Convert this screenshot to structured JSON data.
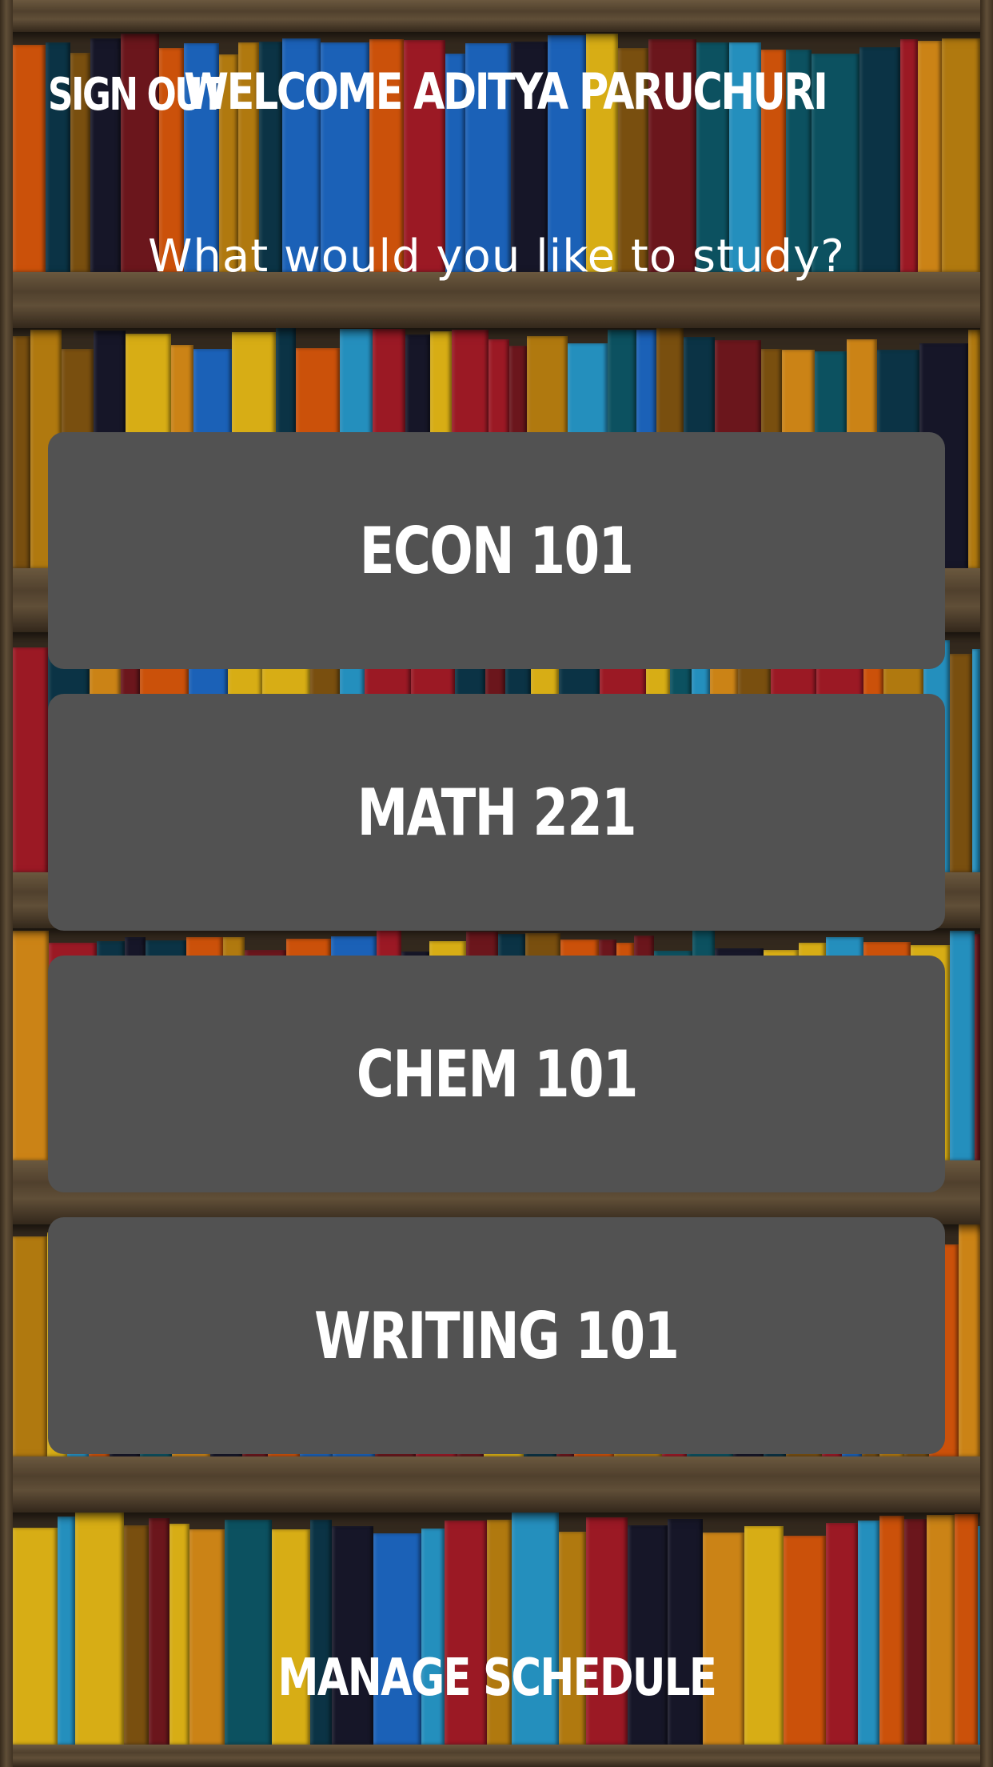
{
  "header": {
    "sign_out_label": "SIGN OUT",
    "welcome_title": "WELCOME ADITYA PARUCHURI"
  },
  "prompt": "What would you like to study?",
  "courses": [
    {
      "label": "ECON 101"
    },
    {
      "label": "MATH 221"
    },
    {
      "label": "CHEM 101"
    },
    {
      "label": "WRITING 101"
    }
  ],
  "footer": {
    "manage_schedule_label": "MANAGE SCHEDULE"
  },
  "colors": {
    "button_bg": "#525252",
    "text": "#ffffff",
    "shelf_wood": "#5c4a34"
  },
  "background": {
    "book_colors": [
      "#f5c518",
      "#e85d0c",
      "#1f6fd1",
      "#2aa3d8",
      "#b11d2a",
      "#7a1a20",
      "#0d3b4f",
      "#8a5a12",
      "#e8961a",
      "#1a1a2e",
      "#0e5d6e",
      "#c98a12"
    ]
  }
}
